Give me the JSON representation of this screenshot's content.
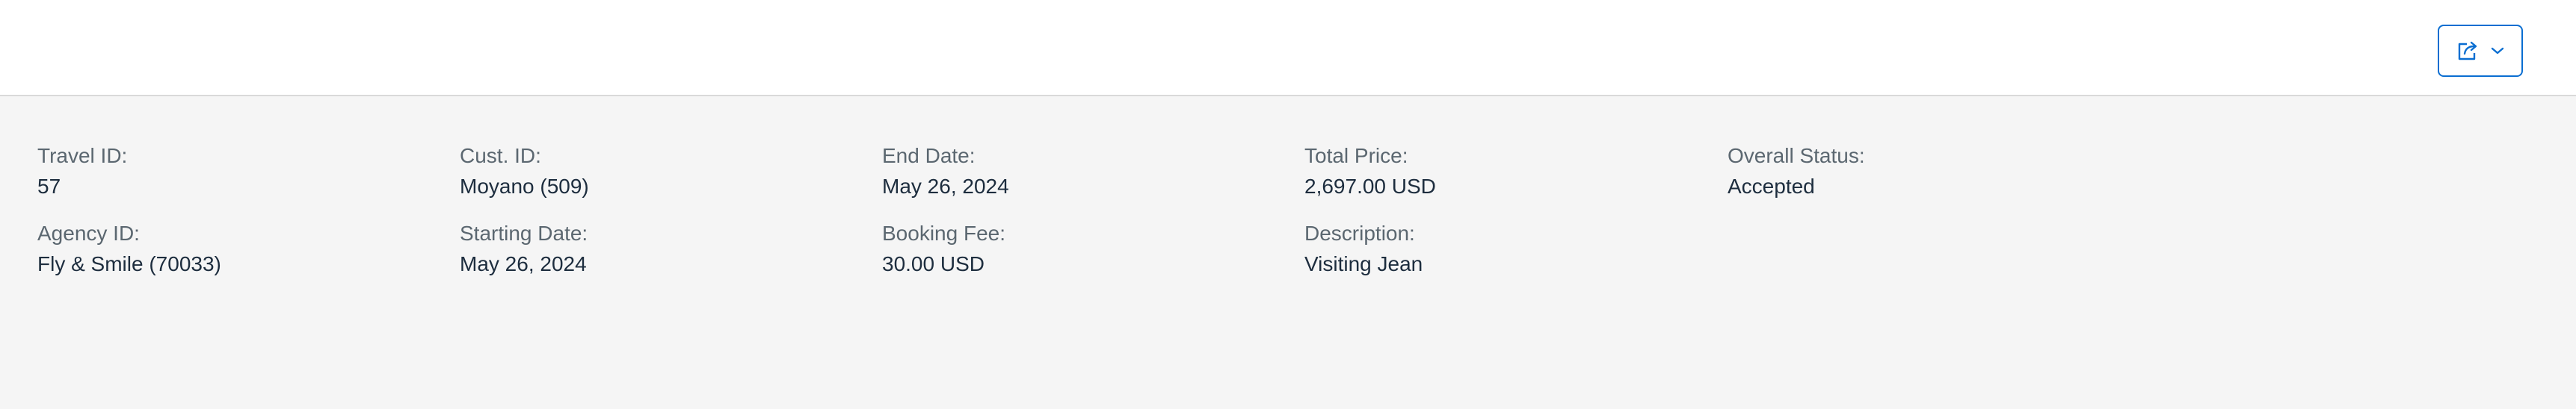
{
  "toolbar": {
    "share_icon": "share-icon",
    "dropdown_icon": "chevron-down-icon",
    "accent_color": "#0a6ed1"
  },
  "header": {
    "travel_id": {
      "label": "Travel ID:",
      "value": "57"
    },
    "agency_id": {
      "label": "Agency ID:",
      "value": "Fly & Smile (70033)"
    },
    "cust_id": {
      "label": "Cust. ID:",
      "value": "Moyano (509)"
    },
    "starting_date": {
      "label": "Starting Date:",
      "value": "May 26, 2024"
    },
    "end_date": {
      "label": "End Date:",
      "value": "May 26, 2024"
    },
    "booking_fee": {
      "label": "Booking Fee:",
      "value": "30.00 USD"
    },
    "total_price": {
      "label": "Total Price:",
      "value": "2,697.00 USD"
    },
    "description": {
      "label": "Description:",
      "value": "Visiting Jean"
    },
    "overall_status": {
      "label": "Overall Status:",
      "value": "Accepted"
    }
  }
}
